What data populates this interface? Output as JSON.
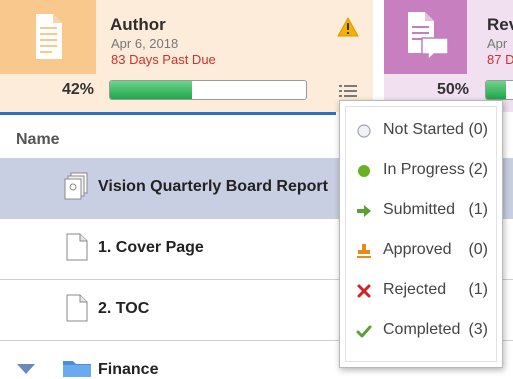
{
  "author": {
    "title": "Author",
    "date": "Apr 6, 2018",
    "due": "83 Days Past Due",
    "percent_label": "42%",
    "progress": 0.42
  },
  "review": {
    "title": "Rev",
    "date": "Apr",
    "due": "87 D",
    "percent_label": "50%",
    "progress": 0.5
  },
  "tree": {
    "header": "Name",
    "rows": [
      {
        "label": "Vision Quarterly Board Report",
        "icon": "multi-document-icon"
      },
      {
        "label": "1. Cover Page",
        "icon": "document-icon"
      },
      {
        "label": "2. TOC",
        "icon": "document-icon"
      },
      {
        "label": "Finance",
        "icon": "folder-icon"
      }
    ]
  },
  "status_menu": {
    "items": [
      {
        "label": "Not Started",
        "count": "(0)",
        "icon": "empty-circle-icon"
      },
      {
        "label": "In Progress",
        "count": "(2)",
        "icon": "green-dot-icon"
      },
      {
        "label": "Submitted",
        "count": "(1)",
        "icon": "right-arrow-icon"
      },
      {
        "label": "Approved",
        "count": "(0)",
        "icon": "stamp-icon"
      },
      {
        "label": "Rejected",
        "count": "(1)",
        "icon": "red-x-icon"
      },
      {
        "label": "Completed",
        "count": "(3)",
        "icon": "checkmark-icon"
      }
    ]
  },
  "colors": {
    "author_bg": "#fcecd9",
    "author_accent": "#f8c88d",
    "review_bg": "#f0e0f0",
    "review_accent": "#c77fbf",
    "past_due": "#d32f2f",
    "progress_green": "#1ea84a",
    "selected_row": "#c8cfe2"
  }
}
